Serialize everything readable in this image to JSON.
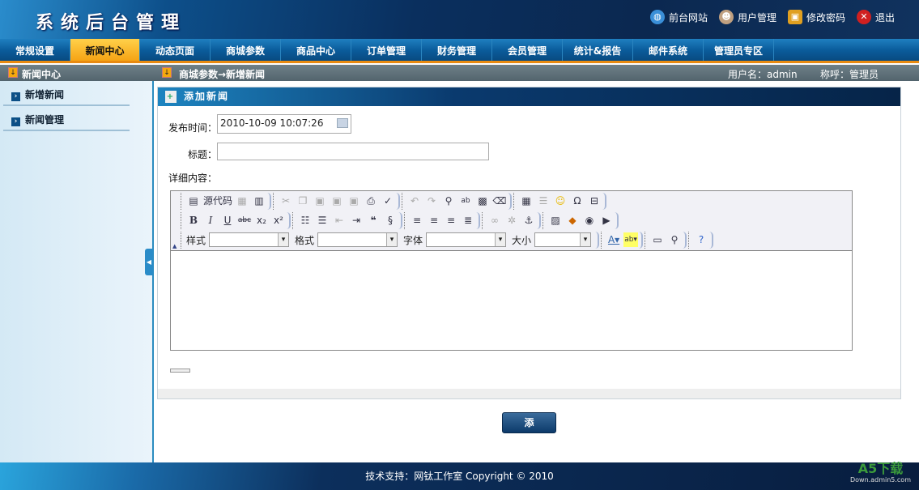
{
  "header": {
    "title": "系统后台管理",
    "links": [
      {
        "label": "前台网站",
        "icon": "globe-icon"
      },
      {
        "label": "用户管理",
        "icon": "user-icon"
      },
      {
        "label": "修改密码",
        "icon": "lock-icon"
      },
      {
        "label": "退出",
        "icon": "close-icon"
      }
    ]
  },
  "nav": {
    "tabs": [
      "常规设置",
      "新闻中心",
      "动态页面",
      "商城参数",
      "商品中心",
      "订单管理",
      "财务管理",
      "会员管理",
      "统计&报告",
      "邮件系统",
      "管理员专区"
    ],
    "active": 1
  },
  "subbar": {
    "left_title": "新闻中心",
    "breadcrumb": "商城参数→新增新闻",
    "username_label": "用户名：admin",
    "role_label": "称呼：管理员"
  },
  "sidebar": {
    "items": [
      "新增新闻",
      "新闻管理"
    ]
  },
  "panel": {
    "title": "添加新闻",
    "publish_time_label": "发布时间：",
    "publish_time_value": "2010-10-09 10:07:26",
    "title_label": "标题：",
    "title_value": "",
    "content_label": "详细内容："
  },
  "editor": {
    "source_label": "源代码",
    "style_label": "样式",
    "format_label": "格式",
    "font_label": "字体",
    "size_label": "大小"
  },
  "submit_label": "添 加",
  "footer": {
    "text": "技术支持：网钛工作室  Copyright © 2010",
    "watermark": "A5下载",
    "watermark_sub": "Down.admin5.com"
  }
}
